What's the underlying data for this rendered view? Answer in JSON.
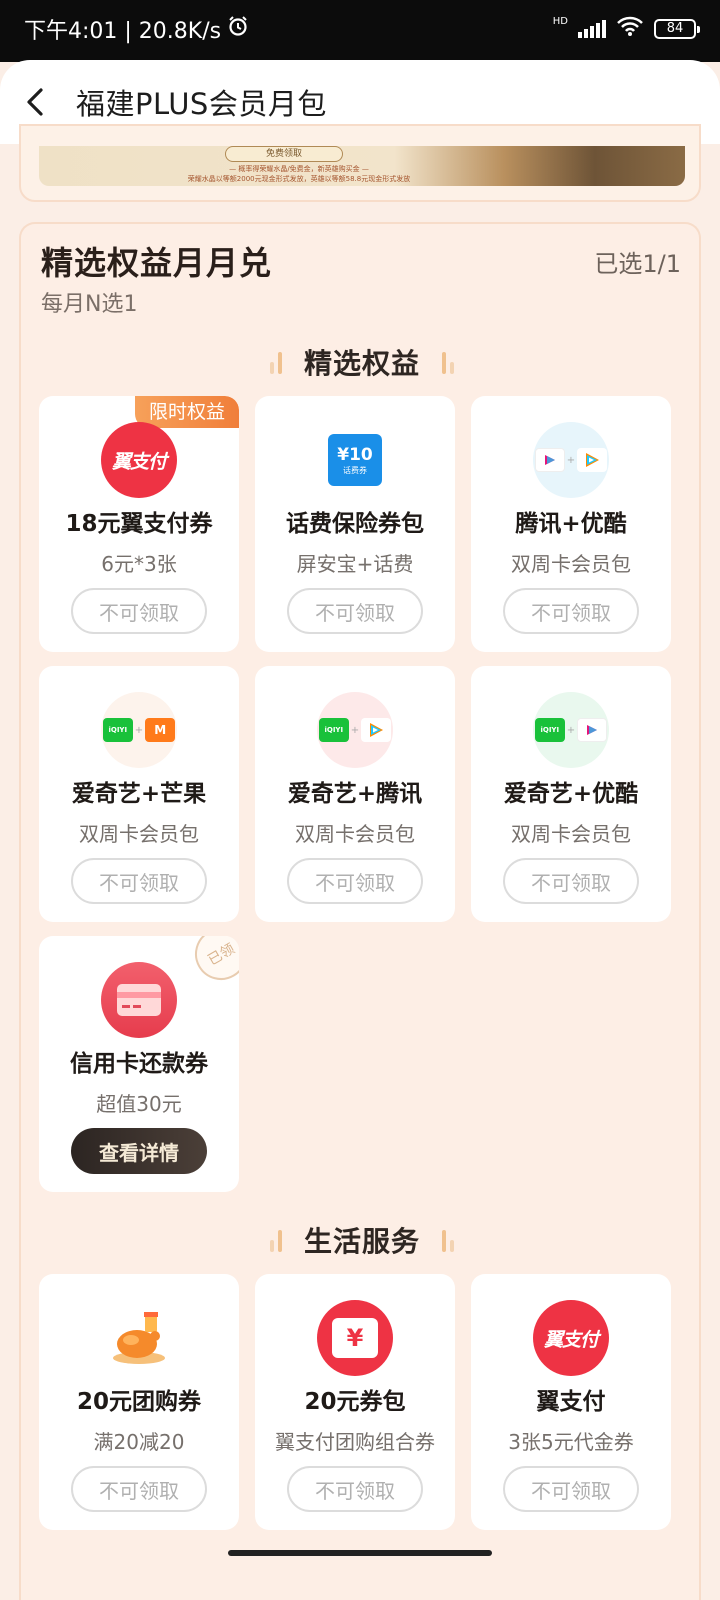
{
  "status_bar": {
    "time_speed": "下午4:01 | 20.8K/s",
    "hd": "HD",
    "battery": "84"
  },
  "header": {
    "title": "福建PLUS会员月包"
  },
  "banner": {
    "pill": "免费领取",
    "line1": "— 概率得荣耀水晶/免费金，新英雄购买金 —",
    "line2": "荣耀水晶以等额2000元现金形式发放，英雄以等额58.8元现金形式发放"
  },
  "card": {
    "title": "精选权益月月兑",
    "subtitle": "每月N选1",
    "selected": "已选1/1"
  },
  "sections": {
    "featured": "精选权益",
    "life": "生活服务"
  },
  "featured_items": [
    {
      "icon": "yizhifu-logo-icon",
      "logo_text": "翼支付",
      "name": "18元翼支付券",
      "desc": "6元*3张",
      "button": "不可领取",
      "tag": "限时权益"
    },
    {
      "icon": "phone-coupon-icon",
      "logo_text": "¥10",
      "logo_sub": "话费券",
      "name": "话费保险券包",
      "desc": "屏安宝+话费",
      "button": "不可领取"
    },
    {
      "icon": "tencent-youku-icon",
      "name": "腾讯+优酷",
      "desc": "双周卡会员包",
      "button": "不可领取"
    },
    {
      "icon": "iqiyi-mango-icon",
      "name": "爱奇艺+芒果",
      "desc": "双周卡会员包",
      "button": "不可领取"
    },
    {
      "icon": "iqiyi-tencent-icon",
      "name": "爱奇艺+腾讯",
      "desc": "双周卡会员包",
      "button": "不可领取"
    },
    {
      "icon": "iqiyi-youku-icon",
      "name": "爱奇艺+优酷",
      "desc": "双周卡会员包",
      "button": "不可领取"
    },
    {
      "icon": "credit-card-icon",
      "name": "信用卡还款券",
      "desc": "超值30元",
      "button": "查看详情",
      "stamp": "已领"
    }
  ],
  "life_items": [
    {
      "icon": "roast-chicken-icon",
      "name": "20元团购券",
      "desc": "满20减20",
      "button": "不可领取"
    },
    {
      "icon": "yuan-ticket-icon",
      "logo_text": "¥",
      "name": "20元券包",
      "desc": "翼支付团购组合券",
      "button": "不可领取"
    },
    {
      "icon": "yizhifu-logo-icon",
      "logo_text": "翼支付",
      "name": "翼支付",
      "desc": "3张5元代金券",
      "button": "不可领取"
    }
  ],
  "colors": {
    "accent_orange": "#f07e3a",
    "brand_red": "#ee3344",
    "card_bg": "#fdeee5",
    "disabled_text": "#b0b0b0"
  }
}
